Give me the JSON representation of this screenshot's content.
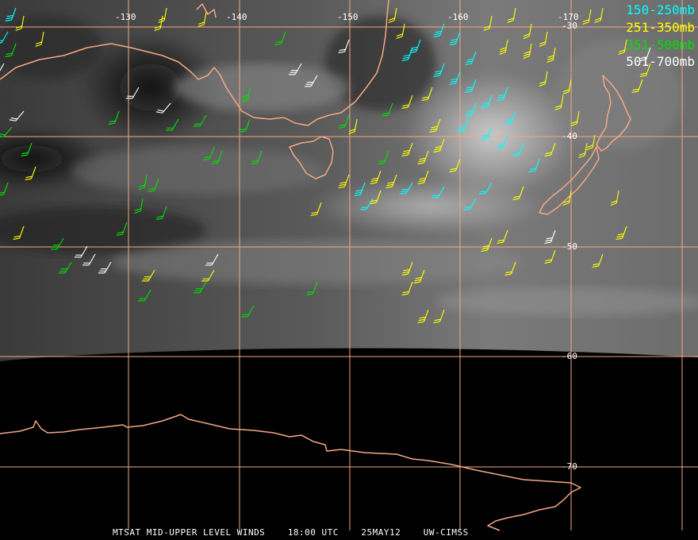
{
  "legend": [
    {
      "label": "150-250mb",
      "color": "#00ffff"
    },
    {
      "label": "251-350mb",
      "color": "#ffff00"
    },
    {
      "label": "351-500mb",
      "color": "#00e000"
    },
    {
      "label": "501-700mb",
      "color": "#ffffff"
    }
  ],
  "longitude_labels": [
    "-130",
    "-140",
    "-150",
    "-160",
    "-170"
  ],
  "latitude_labels": [
    "-30",
    "-40",
    "-50",
    "-60",
    "-70"
  ],
  "footer": {
    "product": "MTSAT MID-UPPER LEVEL WINDS",
    "time": "18:00 UTC",
    "date": "25MAY12",
    "source": "UW-CIMSS"
  },
  "colors": {
    "grid": "#f4a883",
    "coast": "#f4a883",
    "background": "#000000"
  }
}
